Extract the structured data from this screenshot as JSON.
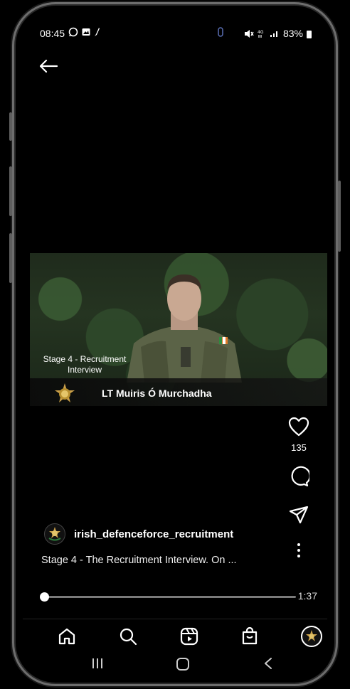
{
  "status_bar": {
    "time": "08:45",
    "battery": "83%"
  },
  "video": {
    "stage_label": "Stage 4 - Recruitment Interview",
    "name_plate": "LT Muiris Ó Murchadha"
  },
  "actions": {
    "like_count": "135"
  },
  "post": {
    "username": "irish_defenceforce_recruitment",
    "caption": "Stage 4 - The Recruitment Interview. On ..."
  },
  "player": {
    "duration": "1:37",
    "progress": 0.0
  },
  "icons": [
    "back-arrow-icon",
    "heart-icon",
    "comment-icon",
    "share-icon",
    "more-icon",
    "home-icon",
    "search-icon",
    "reels-icon",
    "shop-icon",
    "profile-icon"
  ]
}
